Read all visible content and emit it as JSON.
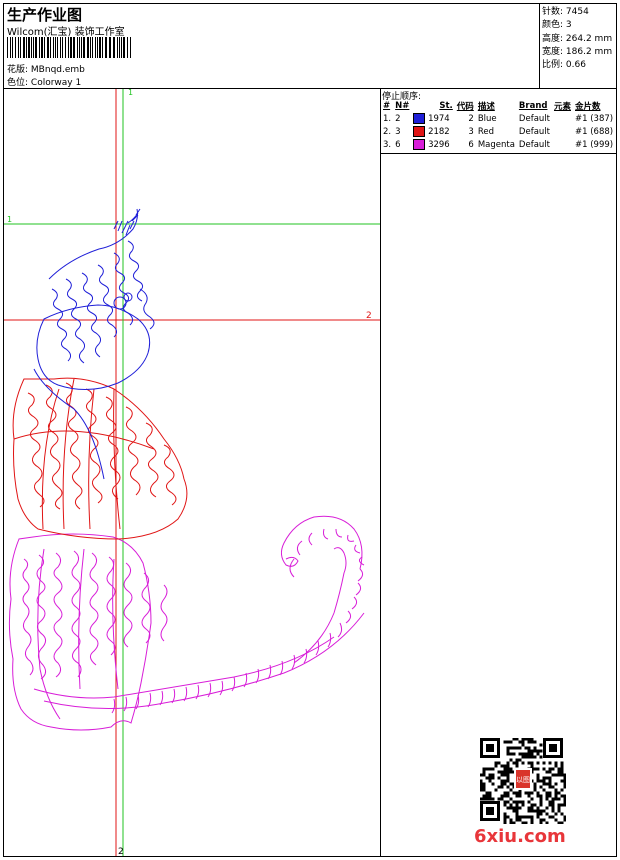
{
  "header": {
    "title": "生产作业图",
    "company": "Wilcom(汇宝) 装饰工作室",
    "design_label": "花版:",
    "design_value": "MBnqd.emb",
    "colorway_label": "色位:",
    "colorway_value": "Colorway 1"
  },
  "stats": [
    {
      "label": "针数:",
      "value": "7454"
    },
    {
      "label": "颜色:",
      "value": "3"
    },
    {
      "label": "高度:",
      "value": "264.2 mm"
    },
    {
      "label": "宽度:",
      "value": "186.2 mm"
    },
    {
      "label": "比例:",
      "value": "0.66"
    }
  ],
  "stop_sequence": {
    "title": "停止顺序:",
    "columns": [
      "#",
      "N#",
      "St.",
      "代码",
      "描述",
      "Brand",
      "元素",
      "金片数"
    ],
    "rows": [
      {
        "idx": "1.",
        "needle": "2",
        "color": "#1f1fd8",
        "stitches": "1974",
        "code": "2",
        "desc": "Blue",
        "brand": "Default",
        "element": "",
        "sequins": "#1 (387)"
      },
      {
        "idx": "2.",
        "needle": "3",
        "color": "#e01515",
        "stitches": "2182",
        "code": "3",
        "desc": "Red",
        "brand": "Default",
        "element": "",
        "sequins": "#1 (688)"
      },
      {
        "idx": "3.",
        "needle": "6",
        "color": "#d81ed8",
        "stitches": "3296",
        "code": "6",
        "desc": "Magenta",
        "brand": "Default",
        "element": "",
        "sequins": "#1 (999)"
      }
    ]
  },
  "guides": {
    "h1": "1",
    "h2": "2",
    "v1": "1",
    "v2": "2"
  },
  "watermark": {
    "site": "6xiu.com",
    "seal": "以图"
  },
  "colors": {
    "blue": "#1f1fd8",
    "red": "#e01515",
    "magenta": "#d81ed8",
    "green_guide": "#22c322",
    "red_guide": "#e01515"
  }
}
